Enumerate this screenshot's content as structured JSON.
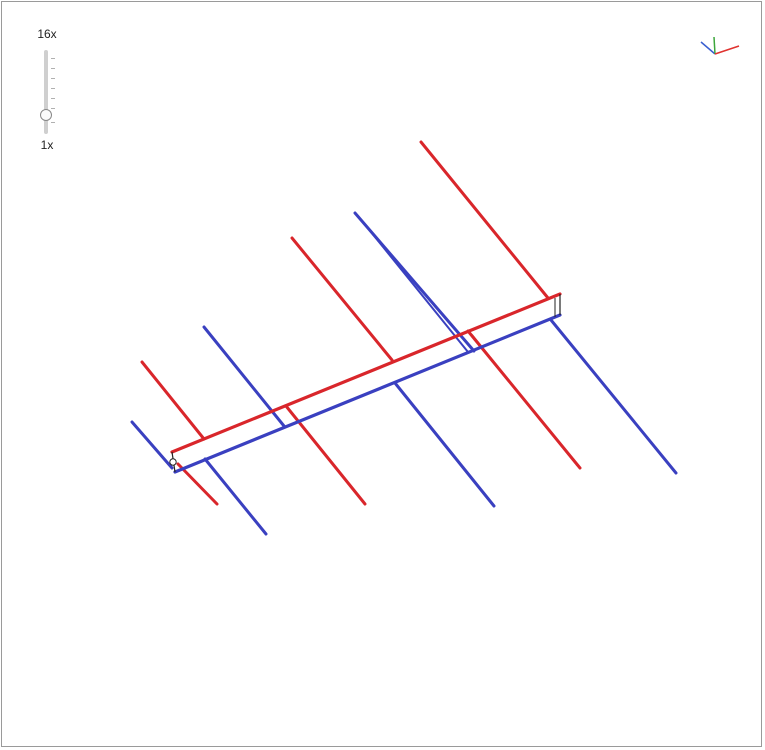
{
  "zoom": {
    "max_label": "16x",
    "min_label": "1x",
    "level": "1x"
  },
  "gizmo": {
    "x_color": "#e0322f",
    "y_color": "#3ca63c",
    "z_color": "#3a5fd0"
  },
  "colors": {
    "red": "#d9262b",
    "blue": "#3a40c0",
    "frame": "#9a9a9a"
  }
}
